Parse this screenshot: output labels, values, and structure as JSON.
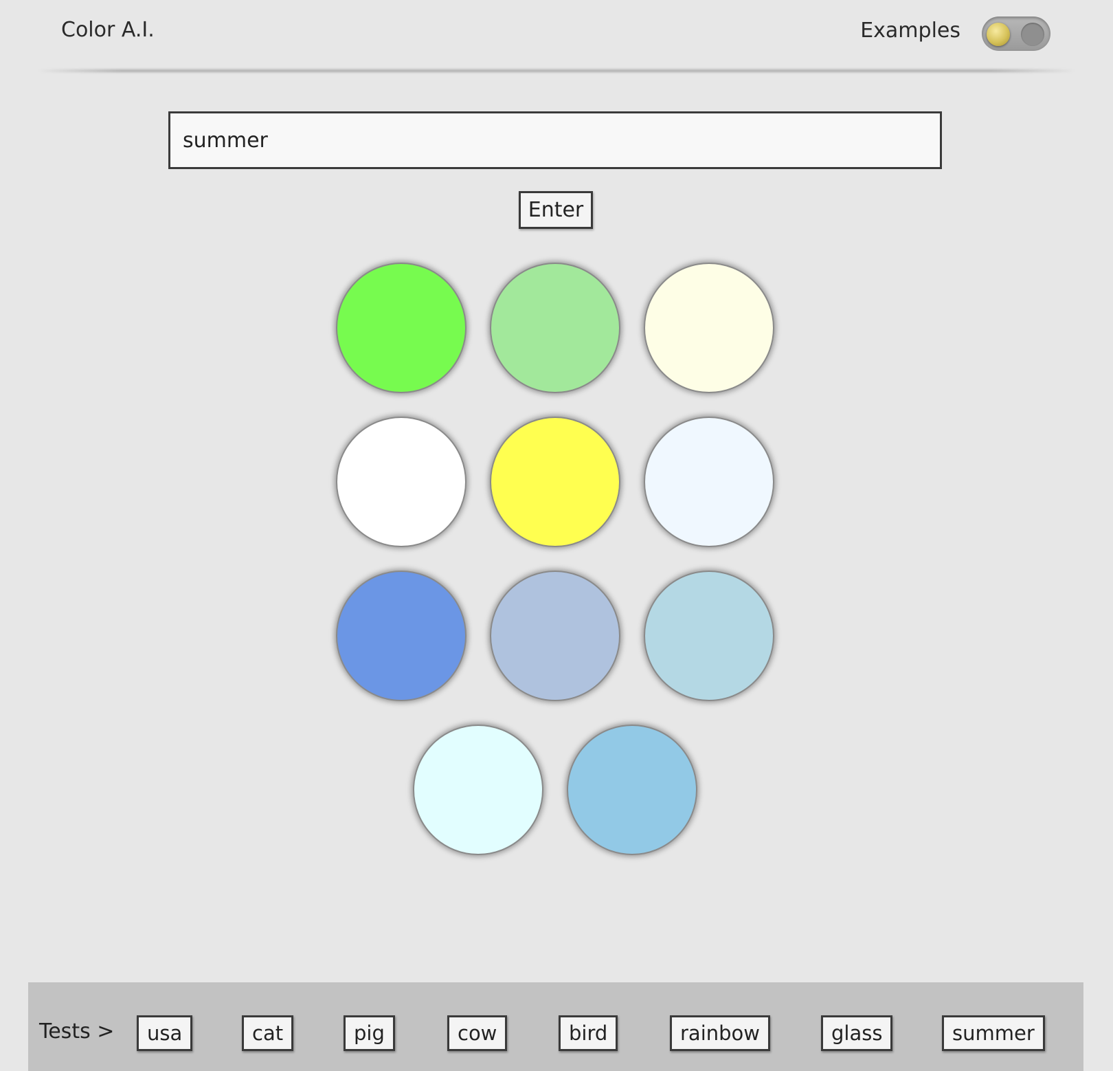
{
  "header": {
    "title": "Color A.I.",
    "examples_label": "Examples",
    "examples_toggle": {
      "on": false,
      "knob_color": "#d6c25a"
    }
  },
  "search": {
    "value": "summer",
    "placeholder": ""
  },
  "enter_label": "Enter",
  "swatches": [
    "#77fb4f",
    "#a2e89b",
    "#fefee6",
    "#ffffff",
    "#ffff50",
    "#f0f8ff",
    "#6b96e5",
    "#afc2de",
    "#b4d8e4",
    "#e2feff",
    "#92c9e6"
  ],
  "footer": {
    "tests_label": "Tests >",
    "tests": [
      "usa",
      "cat",
      "pig",
      "cow",
      "bird",
      "rainbow",
      "glass",
      "summer"
    ]
  }
}
